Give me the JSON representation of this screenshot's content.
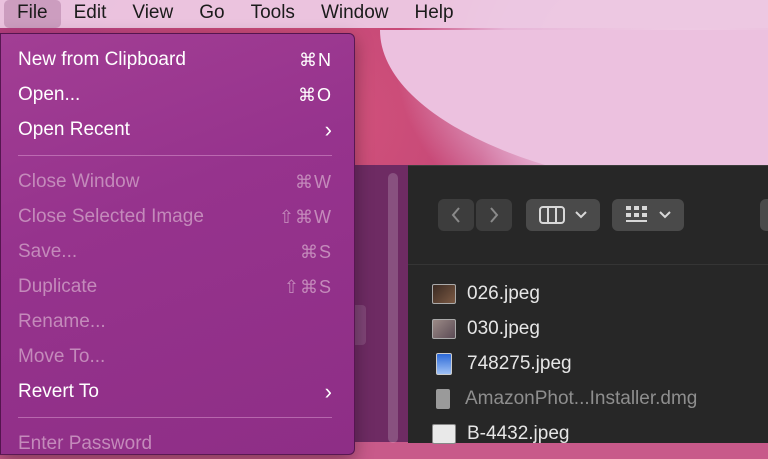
{
  "menubar": {
    "items": [
      "File",
      "Edit",
      "View",
      "Go",
      "Tools",
      "Window",
      "Help"
    ]
  },
  "file_menu": {
    "items": [
      {
        "label": "New from Clipboard",
        "shortcut": "⌘N",
        "enabled": true
      },
      {
        "label": "Open...",
        "shortcut": "⌘O",
        "enabled": true
      },
      {
        "label": "Open Recent",
        "submenu": true,
        "enabled": true
      },
      {
        "label": "Close Window",
        "shortcut": "⌘W",
        "enabled": false
      },
      {
        "label": "Close Selected Image",
        "shortcut": "⇧⌘W",
        "enabled": false
      },
      {
        "label": "Save...",
        "shortcut": "⌘S",
        "enabled": false
      },
      {
        "label": "Duplicate",
        "shortcut": "⇧⌘S",
        "enabled": false
      },
      {
        "label": "Rename...",
        "enabled": false
      },
      {
        "label": "Move To...",
        "enabled": false
      },
      {
        "label": "Revert To",
        "submenu": true,
        "enabled": true
      },
      {
        "label": "Enter Password",
        "enabled": false
      }
    ]
  },
  "finder": {
    "toolbar": {
      "back_icon": "chevron-left-icon",
      "forward_icon": "chevron-right-icon",
      "view_icon": "columns-view-icon",
      "group_icon": "grid-group-icon"
    },
    "files": [
      {
        "name": "026.jpeg",
        "icon": "image-thumbnail",
        "dim": false
      },
      {
        "name": "030.jpeg",
        "icon": "image-thumbnail",
        "dim": false
      },
      {
        "name": "748275.jpeg",
        "icon": "image-thumbnail",
        "dim": false
      },
      {
        "name": "AmazonPhot...Installer.dmg",
        "icon": "disk-image-icon",
        "dim": true
      },
      {
        "name": "B-4432.jpeg",
        "icon": "image-thumbnail",
        "dim": false
      }
    ]
  },
  "colors": {
    "menu_bg": "#96338d",
    "menu_text": "#ffffff",
    "menu_disabled_text": "#c48abb",
    "finder_bg": "#272727"
  }
}
